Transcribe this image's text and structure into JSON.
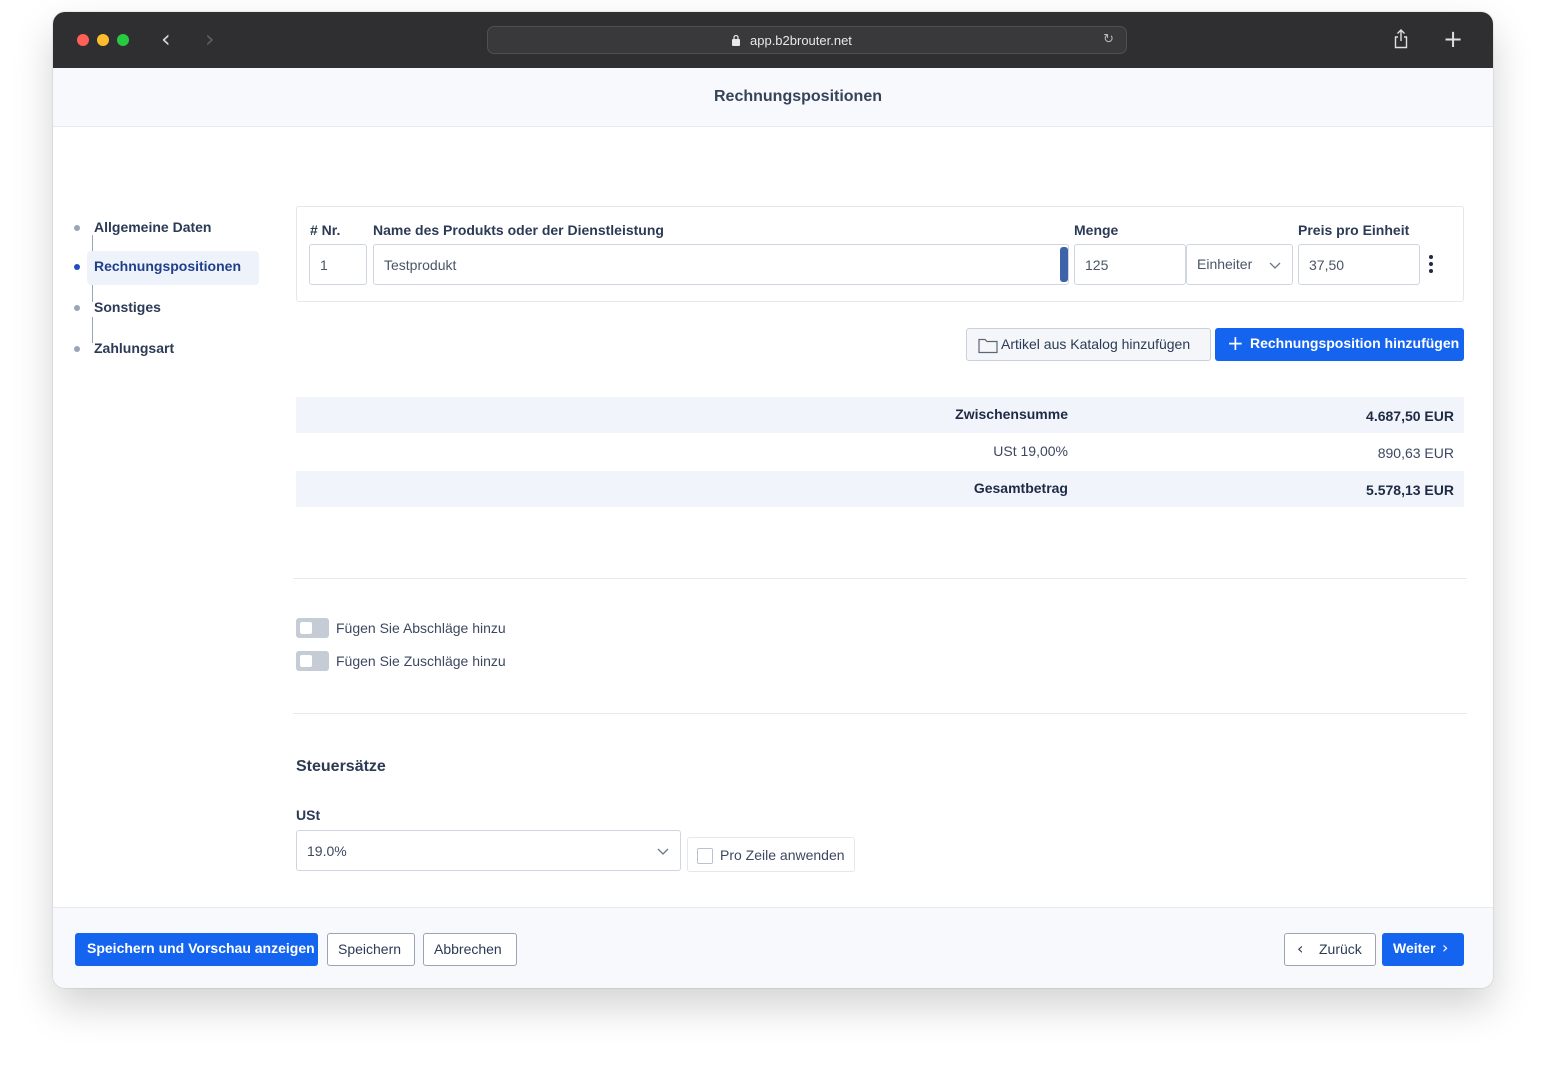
{
  "browser": {
    "url": "app.b2brouter.net"
  },
  "header": {
    "title": "Rechnungspositionen"
  },
  "sidebar": {
    "steps": [
      {
        "label": "Allgemeine Daten",
        "active": false
      },
      {
        "label": "Rechnungspositionen",
        "active": true
      },
      {
        "label": "Sonstiges",
        "active": false
      },
      {
        "label": "Zahlungsart",
        "active": false
      }
    ]
  },
  "line_items": {
    "columns": {
      "number": "# Nr.",
      "name": "Name des Produkts oder der Dienstleistung",
      "quantity": "Menge",
      "price": "Preis pro Einheit"
    },
    "rows": [
      {
        "number": "1",
        "name": "Testprodukt",
        "quantity": "125",
        "unit": "Einheiter",
        "price": "37,50"
      }
    ]
  },
  "actions": {
    "catalog_button": "Artikel aus Katalog hinzufügen",
    "add_position_button": "Rechnungsposition hinzufügen"
  },
  "totals": {
    "subtotal_label": "Zwischensumme",
    "subtotal_value": "4.687,50 EUR",
    "tax_label": "USt 19,00%",
    "tax_value": "890,63 EUR",
    "total_label": "Gesamtbetrag",
    "total_value": "5.578,13 EUR"
  },
  "adjustments": {
    "discounts_label": "Fügen Sie Abschläge hinzu",
    "surcharges_label": "Fügen Sie Zuschläge hinzu"
  },
  "tax_rates": {
    "title": "Steuersätze",
    "ust_label": "USt",
    "ust_value": "19.0%",
    "per_line_label": "Pro Zeile anwenden"
  },
  "footer": {
    "save_preview": "Speichern und Vorschau anzeigen",
    "save": "Speichern",
    "cancel": "Abbrechen",
    "back": "Zurück",
    "next": "Weiter"
  },
  "colors": {
    "primary": "#1464f0",
    "titlebar": "#2f2f31",
    "active_step": "#1f3f8a"
  }
}
